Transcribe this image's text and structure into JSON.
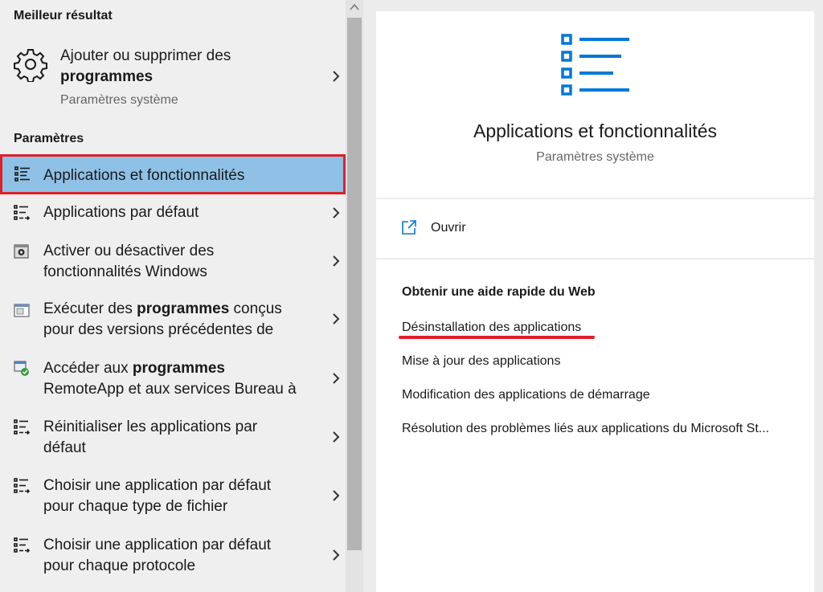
{
  "left": {
    "best_header": "Meilleur résultat",
    "best": {
      "title_prefix": "Ajouter ou supprimer des ",
      "title_bold": "programmes",
      "subtitle": "Paramètres système",
      "icon": "gear-icon"
    },
    "param_header": "Paramètres",
    "items": [
      {
        "line1": "Applications et fonctionnalités",
        "icon": "apps-list-icon",
        "selected": true
      },
      {
        "line1": "Applications par défaut",
        "icon": "apps-default-icon"
      },
      {
        "line1": "Activer ou désactiver des",
        "line2": "fonctionnalités Windows",
        "icon": "windows-features-icon"
      },
      {
        "pre": "Exécuter des ",
        "bold": "programmes",
        "post": " conçus",
        "line2": "pour des versions précédentes de",
        "icon": "compatibility-icon"
      },
      {
        "pre": "Accéder aux ",
        "bold": "programmes",
        "line2": "RemoteApp et aux services Bureau à",
        "icon": "remoteapp-icon"
      },
      {
        "line1": "Réinitialiser les applications par",
        "line2": "défaut",
        "icon": "reset-apps-icon"
      },
      {
        "line1": "Choisir une application par défaut",
        "line2": "pour chaque type de fichier",
        "icon": "filetype-default-icon"
      },
      {
        "line1": "Choisir une application par défaut",
        "line2": "pour chaque protocole",
        "icon": "protocol-default-icon"
      }
    ]
  },
  "right": {
    "icon": "apps-features-icon",
    "title": "Applications et fonctionnalités",
    "subtitle": "Paramètres système",
    "open_label": "Ouvrir",
    "help_title": "Obtenir une aide rapide du Web",
    "help_links": [
      "Désinstallation des applications",
      "Mise à jour des applications",
      "Modification des applications de démarrage",
      "Résolution des problèmes liés aux applications du Microsoft St..."
    ]
  },
  "colors": {
    "accent": "#0078d7",
    "selection": "#8fc1e6",
    "highlight_border": "#e01e26"
  }
}
